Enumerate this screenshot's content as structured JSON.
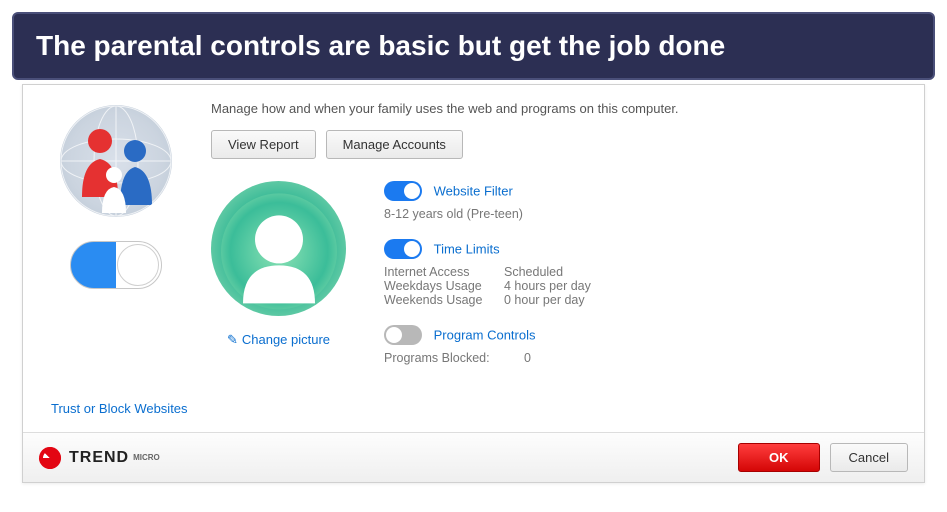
{
  "banner": "The parental controls are basic but get the job done",
  "intro": "Manage how and when your family uses the web and programs on this computer.",
  "buttons": {
    "view_report": "View Report",
    "manage_accounts": "Manage Accounts"
  },
  "profile": {
    "change_picture": "Change picture"
  },
  "sections": {
    "website_filter": {
      "label": "Website Filter",
      "enabled": true,
      "detail": "8-12 years old (Pre-teen)"
    },
    "time_limits": {
      "label": "Time Limits",
      "enabled": true,
      "rows": [
        {
          "label": "Internet Access",
          "value": "Scheduled"
        },
        {
          "label": "Weekdays Usage",
          "value": "4 hours per day"
        },
        {
          "label": "Weekends Usage",
          "value": "0 hour per day"
        }
      ]
    },
    "program_controls": {
      "label": "Program Controls",
      "enabled": false,
      "rows": [
        {
          "label": "Programs Blocked:",
          "value": "0"
        }
      ]
    }
  },
  "master_enabled": true,
  "links": {
    "trust_block": "Trust or Block Websites"
  },
  "footer": {
    "brand": "TREND",
    "ok": "OK",
    "cancel": "Cancel"
  }
}
